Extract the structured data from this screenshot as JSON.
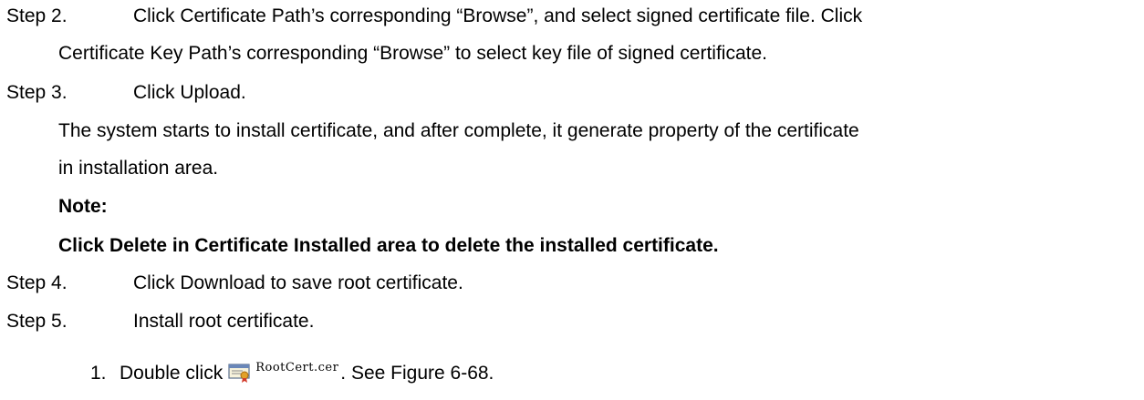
{
  "steps": [
    {
      "label": "Step 2.",
      "lines": [
        "Click Certificate Path’s corresponding “Browse”, and select signed certificate file. Click",
        "Certificate Key Path’s corresponding “Browse” to select key file of signed certificate."
      ]
    },
    {
      "label": "Step 3.",
      "lines": [
        "Click Upload."
      ],
      "body": [
        "The system starts to install certificate, and after complete, it generate property of the certificate",
        "in installation area."
      ],
      "note_heading": "Note:",
      "note_text": "Click Delete in Certificate Installed area to delete the installed certificate."
    },
    {
      "label": "Step 4.",
      "lines": [
        "Click Download to save root certificate."
      ]
    },
    {
      "label": "Step 5.",
      "lines": [
        "Install root certificate."
      ]
    }
  ],
  "substep": {
    "number": "1.",
    "prefix": "Double click",
    "file_name": "RootCert.cer",
    "suffix": ". See Figure 6-68."
  },
  "icons": {
    "file": "certificate-file-icon"
  }
}
